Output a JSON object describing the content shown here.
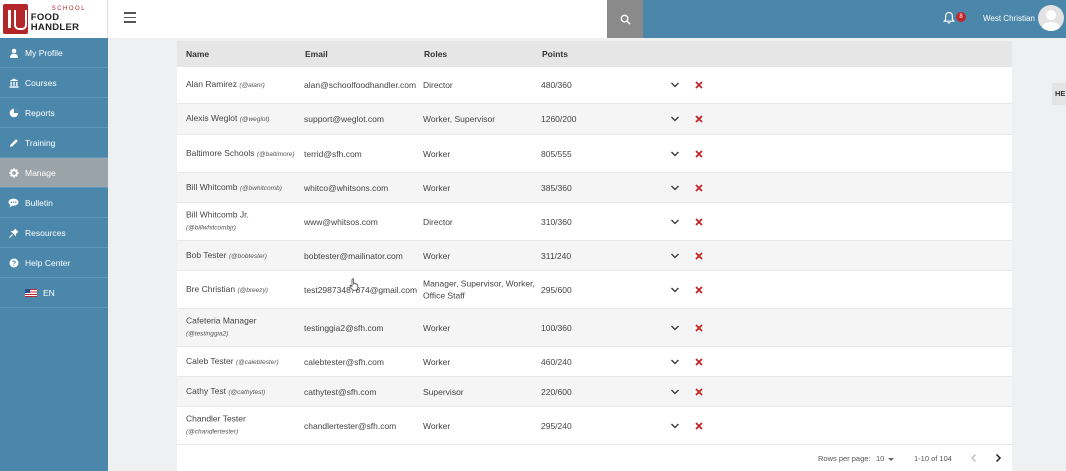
{
  "brand": {
    "logo_small": "SCHOOL",
    "logo_big": "FOOD HANDLER"
  },
  "header": {
    "notification_count": "8",
    "user_name": "West Christian",
    "icons": [
      "menu-icon",
      "search-icon",
      "bell-icon",
      "avatar-icon"
    ]
  },
  "sidebar": {
    "items": [
      {
        "label": "My Profile",
        "icon": "user-icon"
      },
      {
        "label": "Courses",
        "icon": "library-icon"
      },
      {
        "label": "Reports",
        "icon": "pie-chart-icon"
      },
      {
        "label": "Training",
        "icon": "pencil-icon"
      },
      {
        "label": "Manage",
        "icon": "gear-icon",
        "active": true
      },
      {
        "label": "Bulletin",
        "icon": "chat-icon"
      },
      {
        "label": "Resources",
        "icon": "pin-icon"
      },
      {
        "label": "Help Center",
        "icon": "help-icon"
      }
    ],
    "language": "EN"
  },
  "table": {
    "headers": {
      "name": "Name",
      "email": "Email",
      "roles": "Roles",
      "points": "Points"
    },
    "rows": [
      {
        "name": "Alan Ramirez",
        "handle": "(@alanr)",
        "email": "alan@schoolfoodhandler.com",
        "roles": "Director",
        "points": "480/360"
      },
      {
        "name": "Alexis Weglot",
        "handle": "(@weglot)",
        "email": "support@weglot.com",
        "roles": "Worker, Supervisor",
        "points": "1260/200"
      },
      {
        "name": "Baltimore Schools",
        "handle": "(@baltimore)",
        "email": "terrid@sfh.com",
        "roles": "Worker",
        "points": "805/555"
      },
      {
        "name": "Bill Whitcomb",
        "handle": "(@bwhitcomb)",
        "email": "whitco@whitsons.com",
        "roles": "Worker",
        "points": "385/360"
      },
      {
        "name": "Bill Whitcomb Jr.",
        "handle": "(@billwhitcombjr)",
        "email": "www@whitsos.com",
        "roles": "Director",
        "points": "310/360"
      },
      {
        "name": "Bob Tester",
        "handle": "(@bobtester)",
        "email": "bobtester@mailinator.com",
        "roles": "Worker",
        "points": "311/240"
      },
      {
        "name": "Bre Christian",
        "handle": "(@breezy)",
        "email": "test29873487874@gmail.com",
        "roles": "Manager, Supervisor, Worker, Office Staff",
        "points": "295/600"
      },
      {
        "name": "Cafeteria Manager",
        "handle": "(@testinggia2)",
        "email": "testinggia2@sfh.com",
        "roles": "Worker",
        "points": "100/360"
      },
      {
        "name": "Caleb Tester",
        "handle": "(@calebtester)",
        "email": "calebtester@sfh.com",
        "roles": "Worker",
        "points": "460/240"
      },
      {
        "name": "Cathy Test",
        "handle": "(@cathytest)",
        "email": "cathytest@sfh.com",
        "roles": "Supervisor",
        "points": "220/600"
      },
      {
        "name": "Chandler Tester",
        "handle": "(@chandlertester)",
        "email": "chandlertester@sfh.com",
        "roles": "Worker",
        "points": "295/240"
      }
    ]
  },
  "pagination": {
    "rows_per_page_label": "Rows per page:",
    "rows_per_page": "10",
    "range": "1-10 of 104"
  },
  "help_tab": "HE",
  "colors": {
    "brand_blue": "#4a87ab",
    "brand_red": "#b3262a",
    "active_nav": "#9aa3aa",
    "delete_red": "#c0272d"
  }
}
